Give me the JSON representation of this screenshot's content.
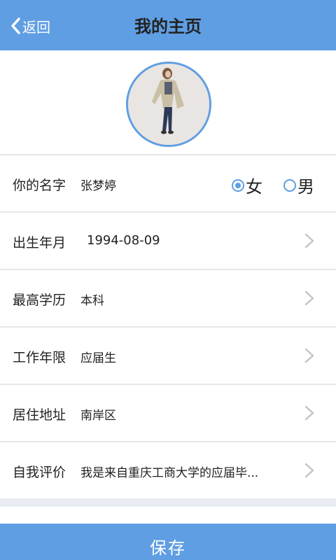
{
  "header": {
    "back_label": "返回",
    "title": "我的主页",
    "back_icon": "chevron-left-icon"
  },
  "colors": {
    "accent": "#5f9ee3",
    "divider": "#e7e7e7"
  },
  "profile": {
    "avatar": "profile-photo"
  },
  "form": {
    "name": {
      "label": "你的名字",
      "value": "张梦婷"
    },
    "gender": {
      "options": [
        {
          "label": "女",
          "selected": true
        },
        {
          "label": "男",
          "selected": false
        }
      ]
    },
    "birth": {
      "label": "出生年月",
      "value": "1994-08-09"
    },
    "education": {
      "label": "最高学历",
      "value": "本科"
    },
    "work_years": {
      "label": "工作年限",
      "value": "应届生"
    },
    "address": {
      "label": "居住地址",
      "value": "南岸区"
    },
    "self_eval": {
      "label": "自我评价",
      "value": "我是来自重庆工商大学的应届毕..."
    }
  },
  "footer": {
    "save_label": "保存"
  }
}
